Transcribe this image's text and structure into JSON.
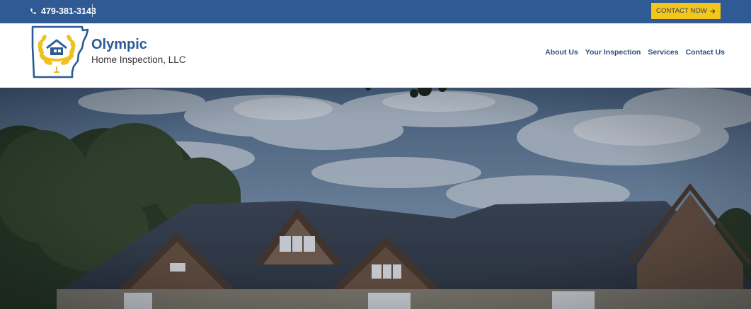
{
  "topbar": {
    "phone": "479-381-3143",
    "phone_icon": "phone-icon",
    "cta_label": "CONTACT NOW",
    "cta_icon": "arrow-right-icon",
    "bg_color": "#2f5a93",
    "cta_color": "#f4c51b"
  },
  "brand": {
    "name": "Olympic",
    "subtitle": "Home Inspection, LLC",
    "logo_icon": "arkansas-state-house-laurel-logo"
  },
  "nav": {
    "items": [
      {
        "label": "About Us"
      },
      {
        "label": "Your Inspection"
      },
      {
        "label": "Services"
      },
      {
        "label": "Contact Us"
      }
    ]
  },
  "hero": {
    "image": "house-exterior-photo"
  },
  "colors": {
    "brand_blue": "#2c5b93",
    "accent_yellow": "#f4c51b"
  }
}
